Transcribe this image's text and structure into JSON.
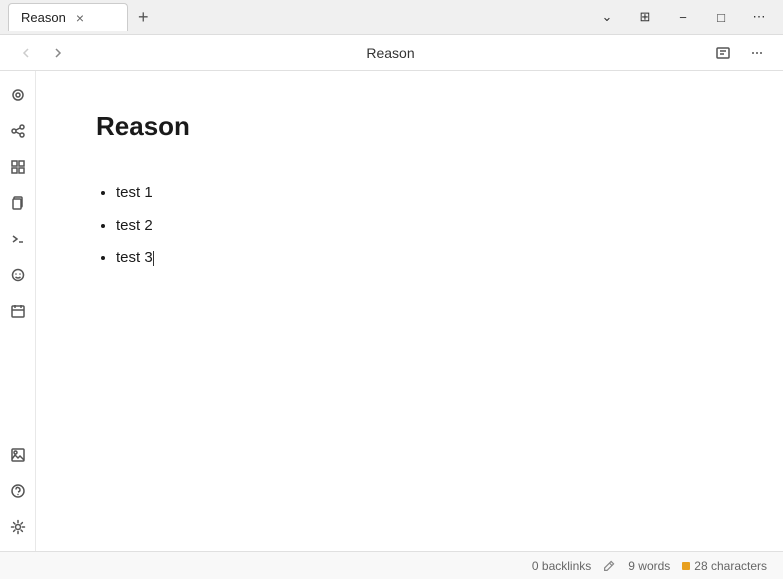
{
  "titlebar": {
    "tab_title": "Reason",
    "close_label": "×",
    "new_tab_label": "+",
    "dropdown_label": "⌄",
    "split_label": "⊞",
    "minimize_label": "−",
    "maximize_label": "□",
    "more_label": "⋯"
  },
  "toolbar": {
    "back_label": "←",
    "forward_label": "→",
    "title": "Reason",
    "reader_icon": "reader",
    "more_icon": "more"
  },
  "sidebar": {
    "icons": [
      {
        "name": "home-icon",
        "symbol": "⊙",
        "interactable": true
      },
      {
        "name": "graph-icon",
        "symbol": "⌘",
        "interactable": true
      },
      {
        "name": "grid-icon",
        "symbol": "⊞",
        "interactable": true
      },
      {
        "name": "pages-icon",
        "symbol": "⎘",
        "interactable": true
      },
      {
        "name": "terminal-icon",
        "symbol": ">_",
        "interactable": true
      },
      {
        "name": "emoji-icon",
        "symbol": "☺",
        "interactable": true
      },
      {
        "name": "calendar-icon",
        "symbol": "⊟",
        "interactable": true
      }
    ],
    "bottom_icons": [
      {
        "name": "image-icon",
        "symbol": "⊡",
        "interactable": true
      },
      {
        "name": "help-icon",
        "symbol": "?",
        "interactable": true
      },
      {
        "name": "settings-icon",
        "symbol": "⚙",
        "interactable": true
      }
    ]
  },
  "content": {
    "title": "Reason",
    "list_items": [
      "test 1",
      "test 2",
      "test 3"
    ]
  },
  "statusbar": {
    "backlinks": "0 backlinks",
    "words": "9 words",
    "characters": "28 characters"
  }
}
